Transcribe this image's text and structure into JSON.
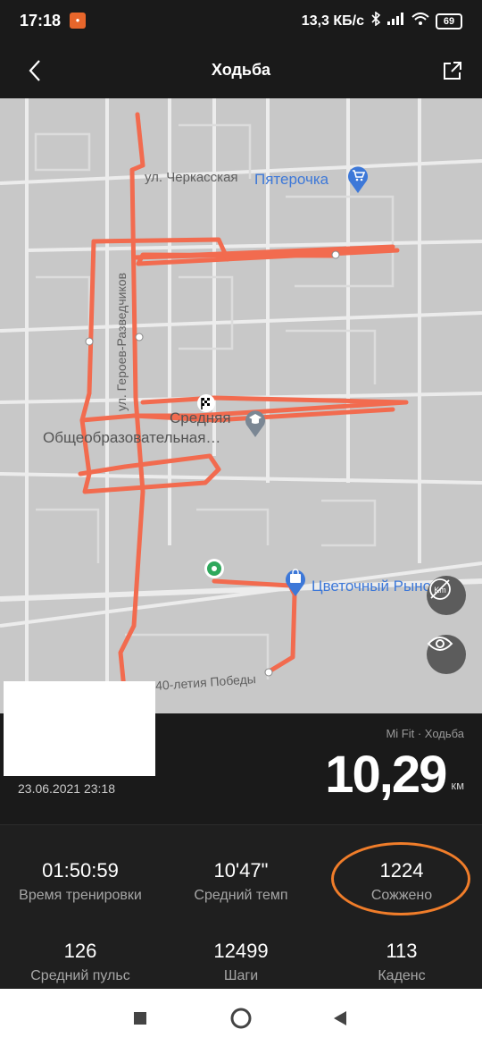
{
  "status": {
    "time": "17:18",
    "app_icon": "app-notification-icon",
    "speed": "13,3 КБ/с",
    "battery": "69"
  },
  "header": {
    "title": "Ходьба",
    "back_icon": "back-chevron-icon",
    "share_icon": "share-icon"
  },
  "map": {
    "labels": {
      "street1": "ул. Черкасская",
      "shop1": "Пятерочка",
      "street2": "ул. Героев-Разведчиков",
      "school_line1": "Средняя",
      "school_line2": "Общеобразовательная…",
      "shop2": "Цветочный Рынок",
      "street3": "40-летия Победы"
    },
    "route_color": "#f26b4f",
    "buttons": [
      "units-toggle-icon",
      "visibility-icon"
    ]
  },
  "summary": {
    "source": "Mi Fit · Ходьба",
    "distance": "10,29",
    "unit": "км",
    "date": "23.06.2021 23:18"
  },
  "stats": [
    {
      "value": "01:50:59",
      "label": "Время тренировки"
    },
    {
      "value": "10'47\"",
      "label": "Средний темп"
    },
    {
      "value": "1224",
      "label": "Сожжено"
    },
    {
      "value": "126",
      "label": "Средний пульс"
    },
    {
      "value": "12499",
      "label": "Шаги"
    },
    {
      "value": "113",
      "label": "Каденс"
    }
  ],
  "highlight_color": "#f07d2a",
  "navbar": [
    "recents-square-icon",
    "home-circle-icon",
    "back-triangle-icon"
  ]
}
